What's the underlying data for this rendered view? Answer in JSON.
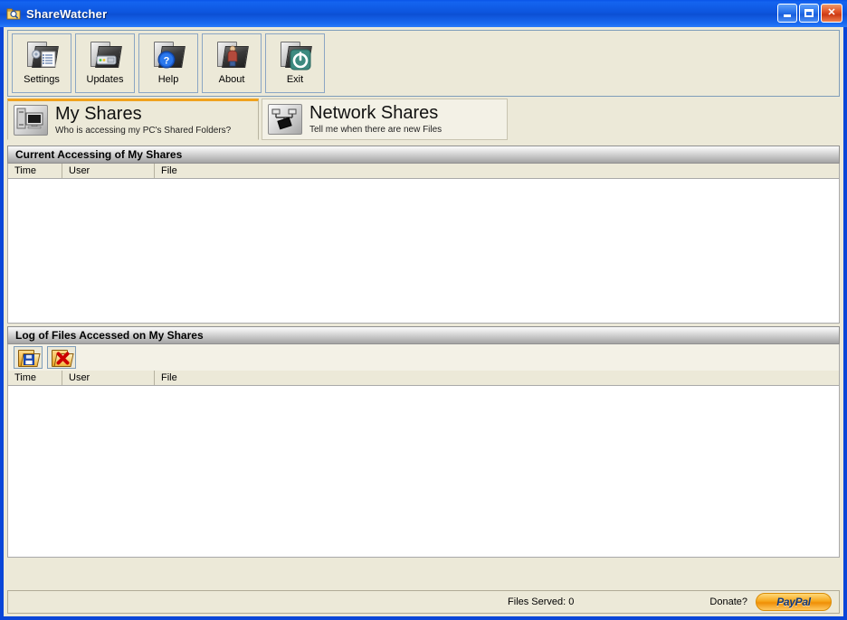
{
  "window": {
    "title": "ShareWatcher",
    "title_icon": "folder-magnifier-icon",
    "buttons": {
      "minimize": "minimize-button",
      "maximize": "maximize-button",
      "close": "close-button"
    }
  },
  "toolbar": {
    "buttons": [
      {
        "label": "Settings",
        "icon": "folder-settings-icon"
      },
      {
        "label": "Updates",
        "icon": "folder-updates-icon"
      },
      {
        "label": "Help",
        "icon": "folder-help-icon"
      },
      {
        "label": "About",
        "icon": "folder-about-icon"
      },
      {
        "label": "Exit",
        "icon": "folder-power-icon"
      }
    ]
  },
  "tabs": [
    {
      "title": "My Shares",
      "subtitle": "Who is accessing my PC's Shared Folders?",
      "icon": "computer-monitor-icon",
      "active": true
    },
    {
      "title": "Network Shares",
      "subtitle": "Tell me when there are new Files",
      "icon": "network-topology-icon",
      "active": false
    }
  ],
  "sections": {
    "current": {
      "header": "Current Accessing of My Shares",
      "columns": [
        "Time",
        "User",
        "File"
      ],
      "rows": []
    },
    "log": {
      "header": "Log of Files Accessed on My Shares",
      "columns": [
        "Time",
        "User",
        "File"
      ],
      "rows": [],
      "actions": [
        {
          "icon": "save-log-icon"
        },
        {
          "icon": "clear-log-icon"
        }
      ]
    }
  },
  "statusbar": {
    "files_served": "Files Served: 0",
    "donate_label": "Donate?",
    "paypal_label": "PayPal",
    "paypal_color": "#f7a71c"
  }
}
